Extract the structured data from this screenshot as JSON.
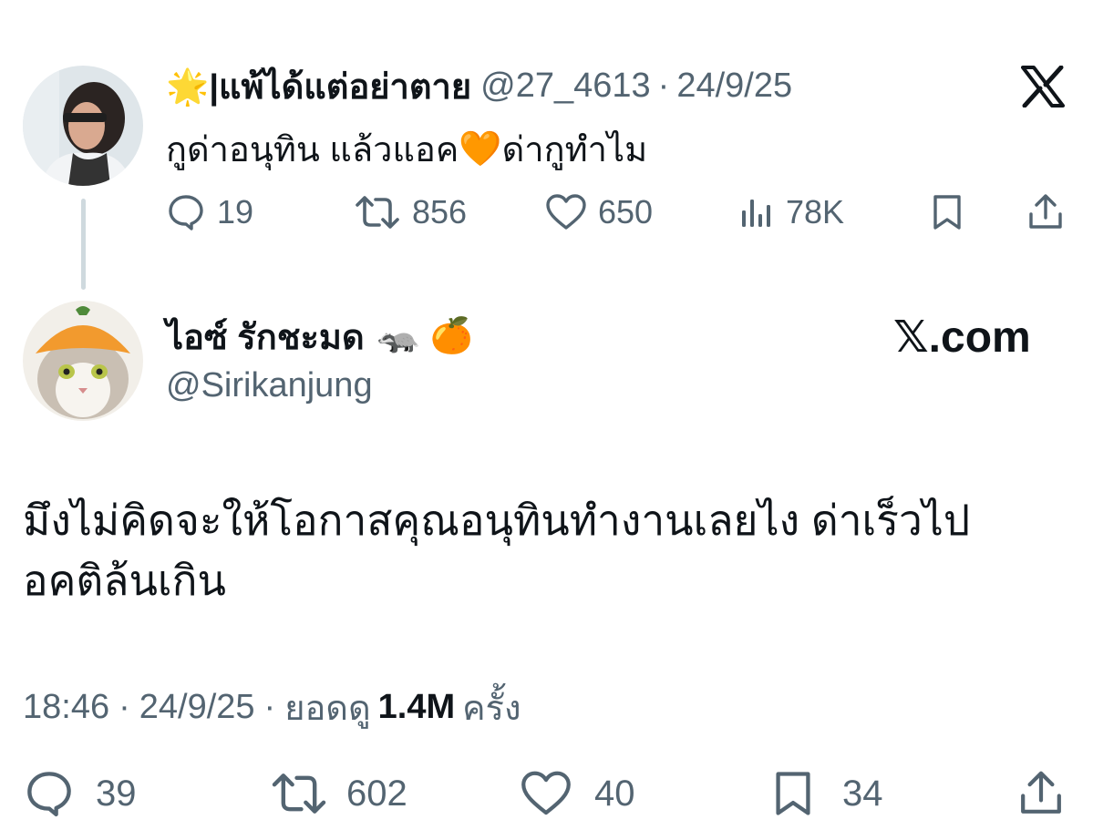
{
  "parent_tweet": {
    "display_name": "🌟|แพ้ได้แต่อย่าตาย",
    "handle": "@27_4613",
    "separator": "·",
    "date": "24/9/25",
    "text_before": "กูด่าอนุทิน แล้วแอค",
    "text_emoji": "🧡",
    "text_after": "ด่ากูทำไม",
    "stats": {
      "replies": "19",
      "reposts": "856",
      "likes": "650",
      "views": "78K"
    }
  },
  "main_tweet": {
    "display_name": "ไอซ์ รักชะมด",
    "name_emojis": "🦡 🍊",
    "handle": "@Sirikanjung",
    "brand": "𝕏.com",
    "text": "มึงไม่คิดจะให้โอกาสคุณอนุทินทำงานเลยไง ด่าเร็วไป อคติล้นเกิน",
    "time": "18:46",
    "separator": "·",
    "date": "24/9/25",
    "views_prefix": "ยอดดู",
    "views_count": "1.4M",
    "views_suffix": "ครั้ง",
    "stats": {
      "replies": "39",
      "reposts": "602",
      "likes": "40",
      "bookmarks": "34"
    }
  },
  "colors": {
    "text_primary": "#0f1419",
    "text_secondary": "#536471",
    "thread_line": "#cfd9de"
  },
  "icons": [
    "reply-icon",
    "repost-icon",
    "like-icon",
    "views-icon",
    "bookmark-icon",
    "share-icon",
    "x-logo-icon"
  ]
}
